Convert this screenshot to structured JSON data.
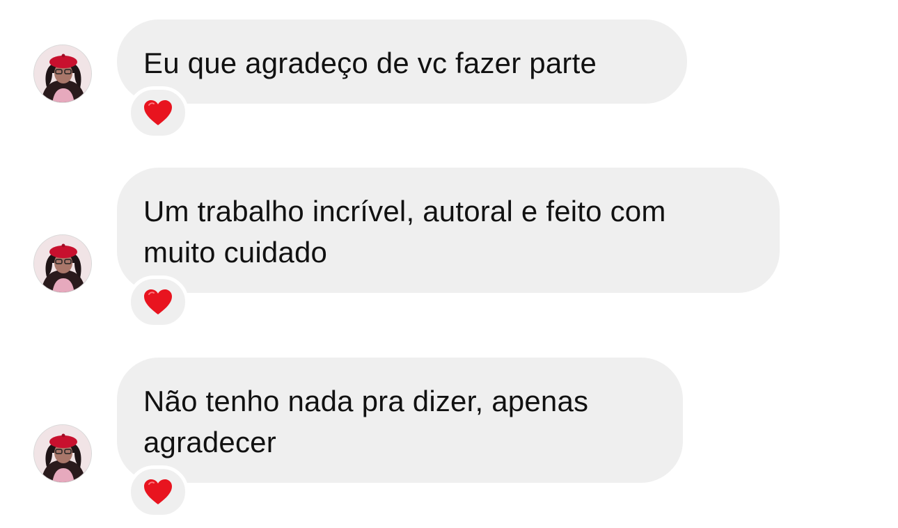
{
  "messages": [
    {
      "text": "Eu que agradeço de vc fazer parte",
      "reaction": "heart-emoji",
      "avatar": "profile-avatar"
    },
    {
      "text": "Um trabalho incrível, autoral e feito com\nmuito cuidado",
      "reaction": "heart-emoji",
      "avatar": "profile-avatar"
    },
    {
      "text": "Não tenho nada pra dizer, apenas\nagradecer",
      "reaction": "heart-emoji",
      "avatar": "profile-avatar"
    }
  ],
  "colors": {
    "bubble": "#efefef",
    "heart": "#e8141f",
    "avatar_hat": "#c8102e"
  }
}
